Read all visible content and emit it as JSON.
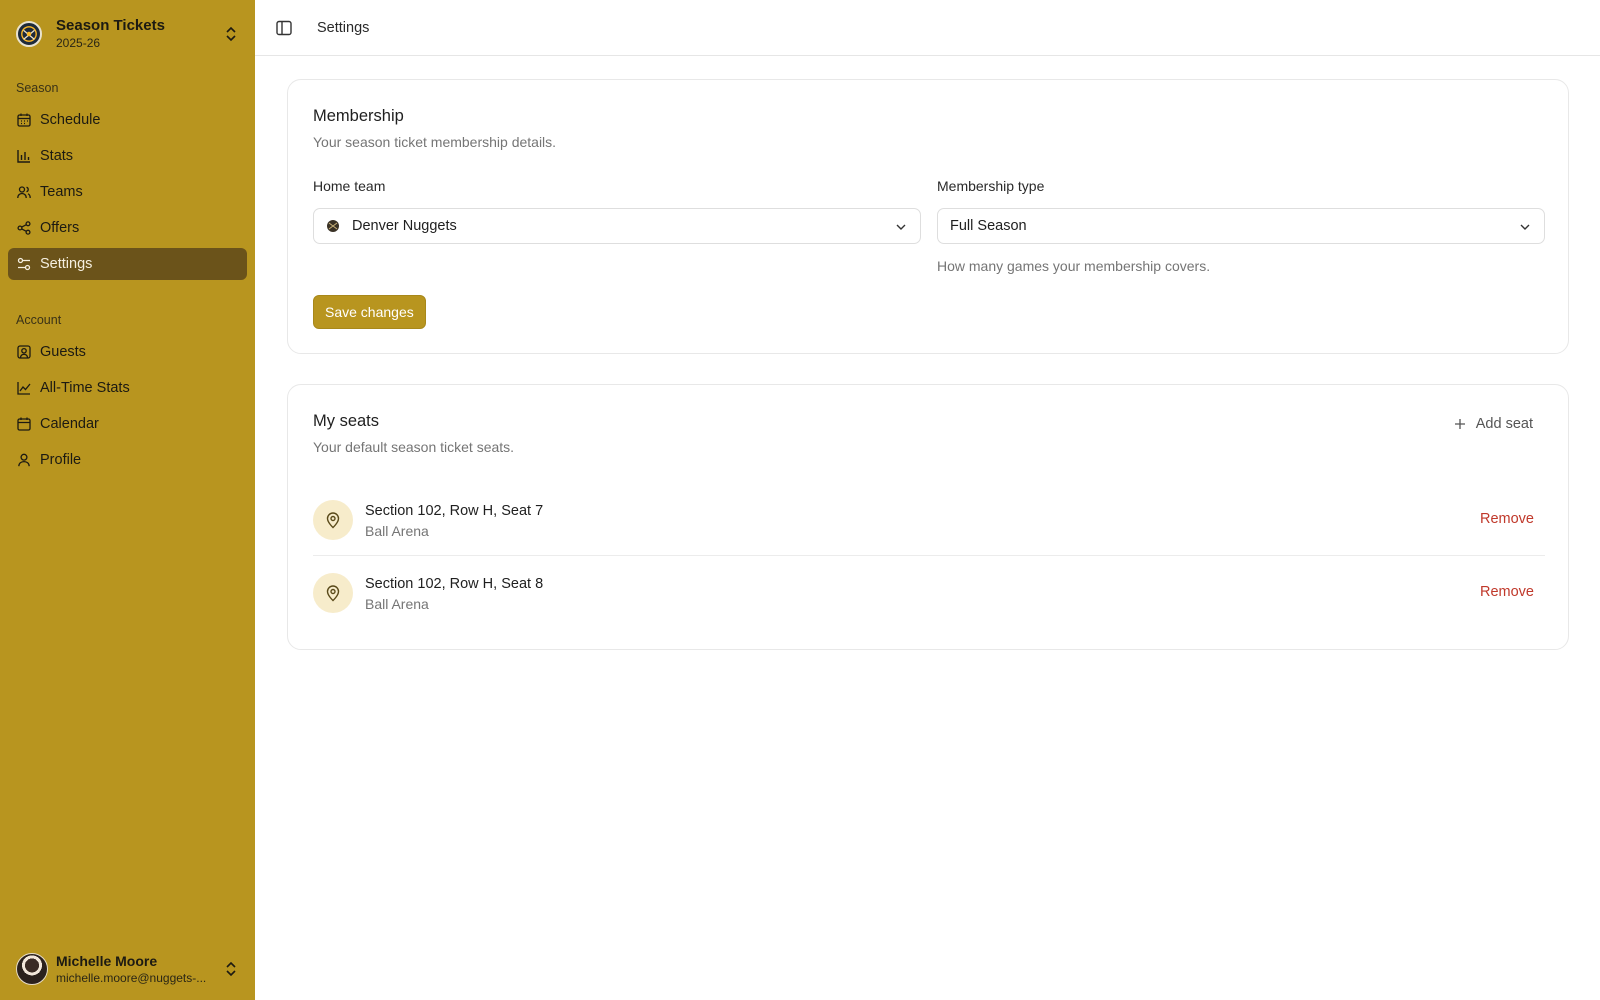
{
  "brand": {
    "title": "Season Tickets",
    "subtitle": "2025-26"
  },
  "sidebar": {
    "season_label": "Season",
    "season_items": [
      {
        "label": "Schedule",
        "icon": "calendar-grid-icon"
      },
      {
        "label": "Stats",
        "icon": "bar-chart-icon"
      },
      {
        "label": "Teams",
        "icon": "users-icon"
      },
      {
        "label": "Offers",
        "icon": "share-icon"
      },
      {
        "label": "Settings",
        "icon": "sliders-icon",
        "active": true
      }
    ],
    "account_label": "Account",
    "account_items": [
      {
        "label": "Guests",
        "icon": "contact-icon"
      },
      {
        "label": "All-Time Stats",
        "icon": "line-chart-icon"
      },
      {
        "label": "Calendar",
        "icon": "calendar-icon"
      },
      {
        "label": "Profile",
        "icon": "user-icon"
      }
    ]
  },
  "user": {
    "name": "Michelle Moore",
    "email": "michelle.moore@nuggets-..."
  },
  "topbar": {
    "title": "Settings"
  },
  "membership": {
    "title": "Membership",
    "description": "Your season ticket membership details.",
    "home_team_label": "Home team",
    "home_team_value": "Denver Nuggets",
    "membership_type_label": "Membership type",
    "membership_type_value": "Full Season",
    "membership_type_helper": "How many games your membership covers.",
    "save_label": "Save changes"
  },
  "seats": {
    "title": "My seats",
    "description": "Your default season ticket seats.",
    "add_label": "Add seat",
    "remove_label": "Remove",
    "items": [
      {
        "title": "Section 102, Row H, Seat 7",
        "venue": "Ball Arena"
      },
      {
        "title": "Section 102, Row H, Seat 8",
        "venue": "Ball Arena"
      }
    ]
  },
  "colors": {
    "sidebar": "#b8951f",
    "active_nav": "#6b531a",
    "remove": "#c0392b",
    "accent": "#b8951f"
  }
}
